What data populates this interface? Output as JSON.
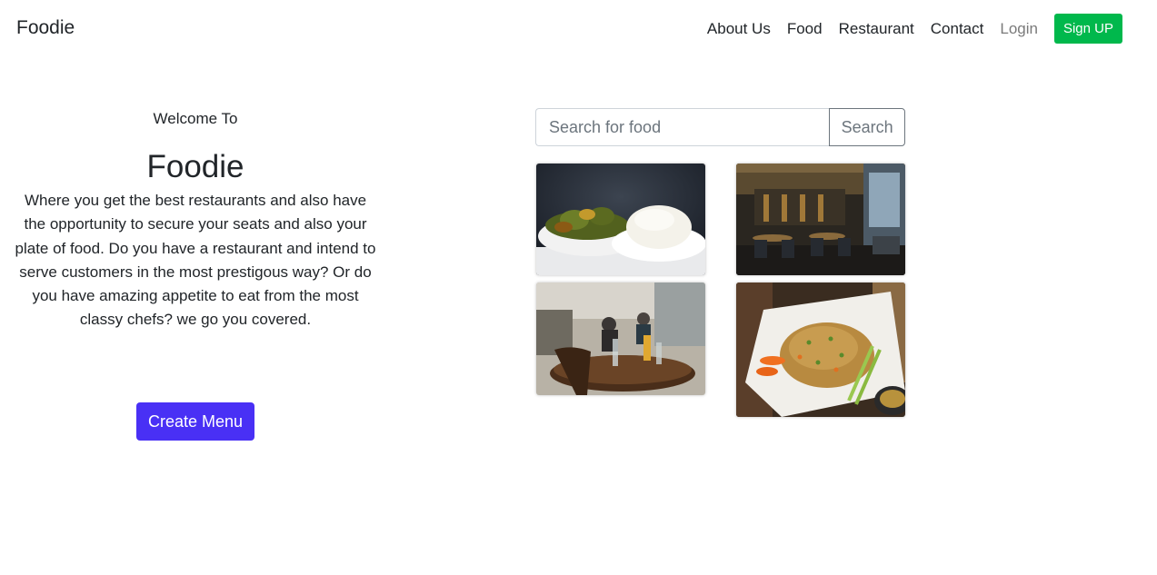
{
  "navbar": {
    "brand": "Foodie",
    "links": [
      "About Us",
      "Food",
      "Restaurant",
      "Contact"
    ],
    "login": "Login",
    "signup": "Sign UP"
  },
  "hero": {
    "welcome": "Welcome To",
    "title": "Foodie",
    "description": "Where you get the best restaurants and also have the opportunity to secure your seats and also your plate of food. Do you have a restaurant and intend to serve customers in the most prestigous way? Or do you have amazing appetite to eat from the most classy chefs? we go you covered.",
    "cta": "Create Menu"
  },
  "search": {
    "placeholder": "Search for food",
    "button": "Search"
  },
  "colors": {
    "signup": "#00b84c",
    "cta": "#4930f5"
  },
  "gallery": [
    {
      "name": "vegetable-soup-with-fufu-photo"
    },
    {
      "name": "restaurant-interior-photo"
    },
    {
      "name": "cafe-table-photo"
    },
    {
      "name": "fried-rice-plate-photo"
    }
  ]
}
